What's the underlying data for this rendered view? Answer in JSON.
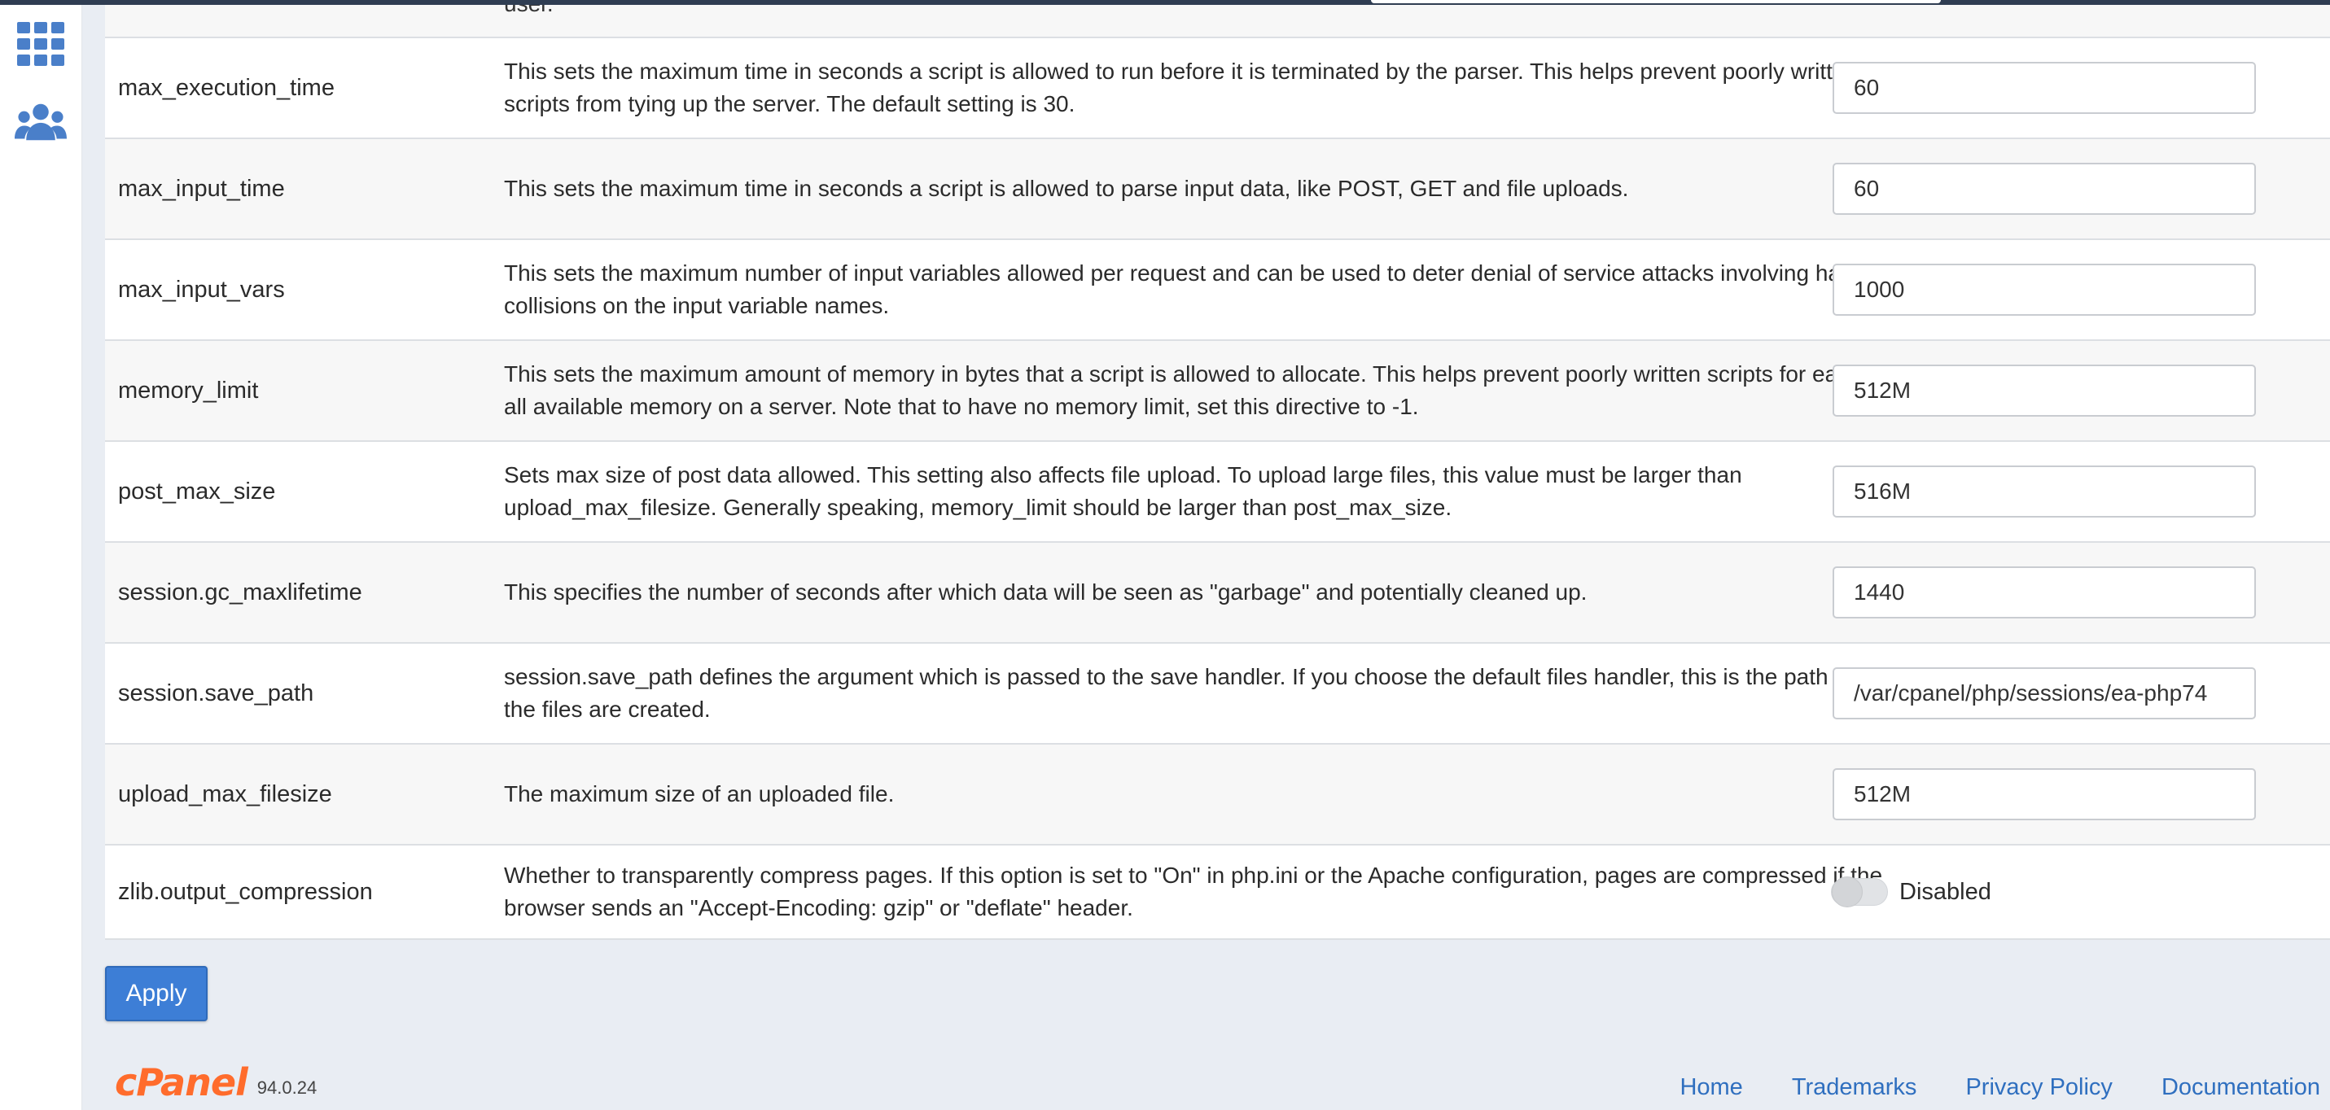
{
  "rail": {
    "icons": [
      "apps-grid-icon",
      "users-icon"
    ],
    "icon_color": "#4a7fc9"
  },
  "previous_row": {
    "description_tail": "user."
  },
  "rows": [
    {
      "name": "max_execution_time",
      "description": "This sets the maximum time in seconds a script is allowed to run before it is terminated by the parser. This helps prevent poorly written scripts from tying up the server. The default setting is 30.",
      "value": "60"
    },
    {
      "name": "max_input_time",
      "description": "This sets the maximum time in seconds a script is allowed to parse input data, like POST, GET and file uploads.",
      "value": "60"
    },
    {
      "name": "max_input_vars",
      "description": "This sets the maximum number of input variables allowed per request and can be used to deter denial of service attacks involving hash collisions on the input variable names.",
      "value": "1000"
    },
    {
      "name": "memory_limit",
      "description": "This sets the maximum amount of memory in bytes that a script is allowed to allocate. This helps prevent poorly written scripts for eating up all available memory on a server. Note that to have no memory limit, set this directive to -1.",
      "value": "512M"
    },
    {
      "name": "post_max_size",
      "description": "Sets max size of post data allowed. This setting also affects file upload. To upload large files, this value must be larger than upload_max_filesize. Generally speaking, memory_limit should be larger than post_max_size.",
      "value": "516M"
    },
    {
      "name": "session.gc_maxlifetime",
      "description": "This specifies the number of seconds after which data will be seen as \"garbage\" and potentially cleaned up.",
      "value": "1440"
    },
    {
      "name": "session.save_path",
      "description": "session.save_path defines the argument which is passed to the save handler. If you choose the default files handler, this is the path where the files are created.",
      "value": "/var/cpanel/php/sessions/ea-php74"
    },
    {
      "name": "upload_max_filesize",
      "description": "The maximum size of an uploaded file.",
      "value": "512M"
    }
  ],
  "toggle_row": {
    "name": "zlib.output_compression",
    "description": "Whether to transparently compress pages. If this option is set to \"On\" in php.ini or the Apache configuration, pages are compressed if the browser sends an \"Accept-Encoding: gzip\" or \"deflate\" header.",
    "state_label": "Disabled",
    "enabled": false
  },
  "apply_label": "Apply",
  "footer": {
    "logo_text": "cPanel",
    "version": "94.0.24",
    "links": [
      "Home",
      "Trademarks",
      "Privacy Policy",
      "Documentation"
    ]
  },
  "colors": {
    "accent": "#3d7ed6",
    "logo": "#ff6c2c",
    "link": "#2f6fbf",
    "background": "#e9edf3"
  }
}
